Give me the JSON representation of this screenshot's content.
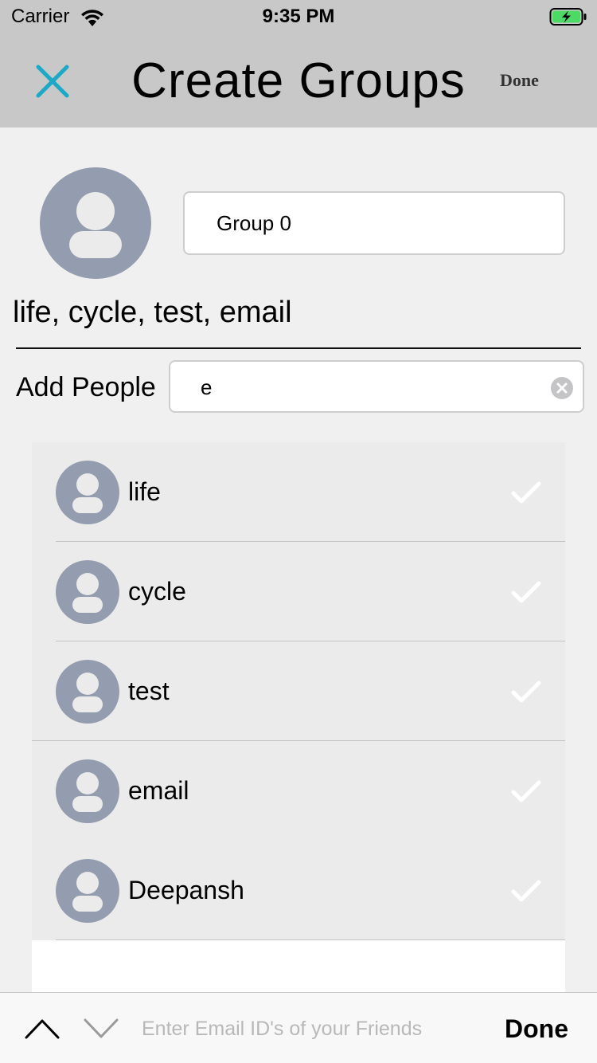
{
  "status_bar": {
    "carrier": "Carrier",
    "time": "9:35 PM",
    "icons": [
      "wifi-icon",
      "battery-charging-icon"
    ]
  },
  "nav": {
    "title": "Create Groups",
    "done_label": "Done",
    "close_icon": "close-icon",
    "accent_color": "#1aa9c7"
  },
  "group": {
    "name_value": "Group 0",
    "members_summary": "life, cycle, test, email",
    "avatar_icon": "person-icon",
    "avatar_color": "#949caf"
  },
  "add_people": {
    "label": "Add People",
    "search_value": "e",
    "clear_icon": "clear-icon"
  },
  "results": [
    {
      "name": "life",
      "checked": true
    },
    {
      "name": "cycle",
      "checked": true
    },
    {
      "name": "test",
      "checked": true
    },
    {
      "name": "email",
      "checked": true
    },
    {
      "name": "Deepansh",
      "checked": true
    }
  ],
  "accessory": {
    "email_placeholder": "Enter Email ID's of your Friends",
    "done_label": "Done",
    "up_icon": "chevron-up-icon",
    "down_icon": "chevron-down-icon"
  }
}
